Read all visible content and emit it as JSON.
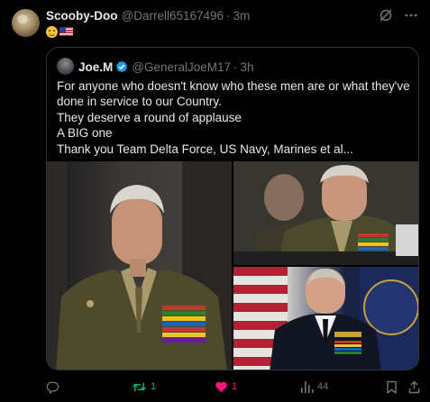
{
  "post": {
    "author_name": "Scooby-Doo",
    "author_handle": "@Darrell65167496",
    "separator": "·",
    "time": "3m"
  },
  "quoted": {
    "author_name": "Joe.M",
    "author_handle": "@GeneralJoeM17",
    "separator": "·",
    "time": "3h",
    "text_lines": [
      "For anyone who doesn't know who these men are or what they've done in service to our Country.",
      "They deserve a round of applause",
      "A BIG one",
      "Thank you Team Delta Force, US Navy, Marines et al..."
    ]
  },
  "actions": {
    "reply_count": "",
    "repost_count": "1",
    "like_count": "1",
    "views_count": "44"
  },
  "colors": {
    "background": "#000000",
    "text_primary": "#e7e9ea",
    "text_secondary": "#71767b",
    "border": "#2f3336",
    "repost_active": "#00ba7c",
    "like_active": "#f91880",
    "verified": "#1d9bf0"
  },
  "icons": [
    "grok-icon",
    "more-icon",
    "verified-badge-icon",
    "reply-icon",
    "repost-icon",
    "like-icon",
    "views-icon",
    "bookmark-icon",
    "share-icon"
  ]
}
